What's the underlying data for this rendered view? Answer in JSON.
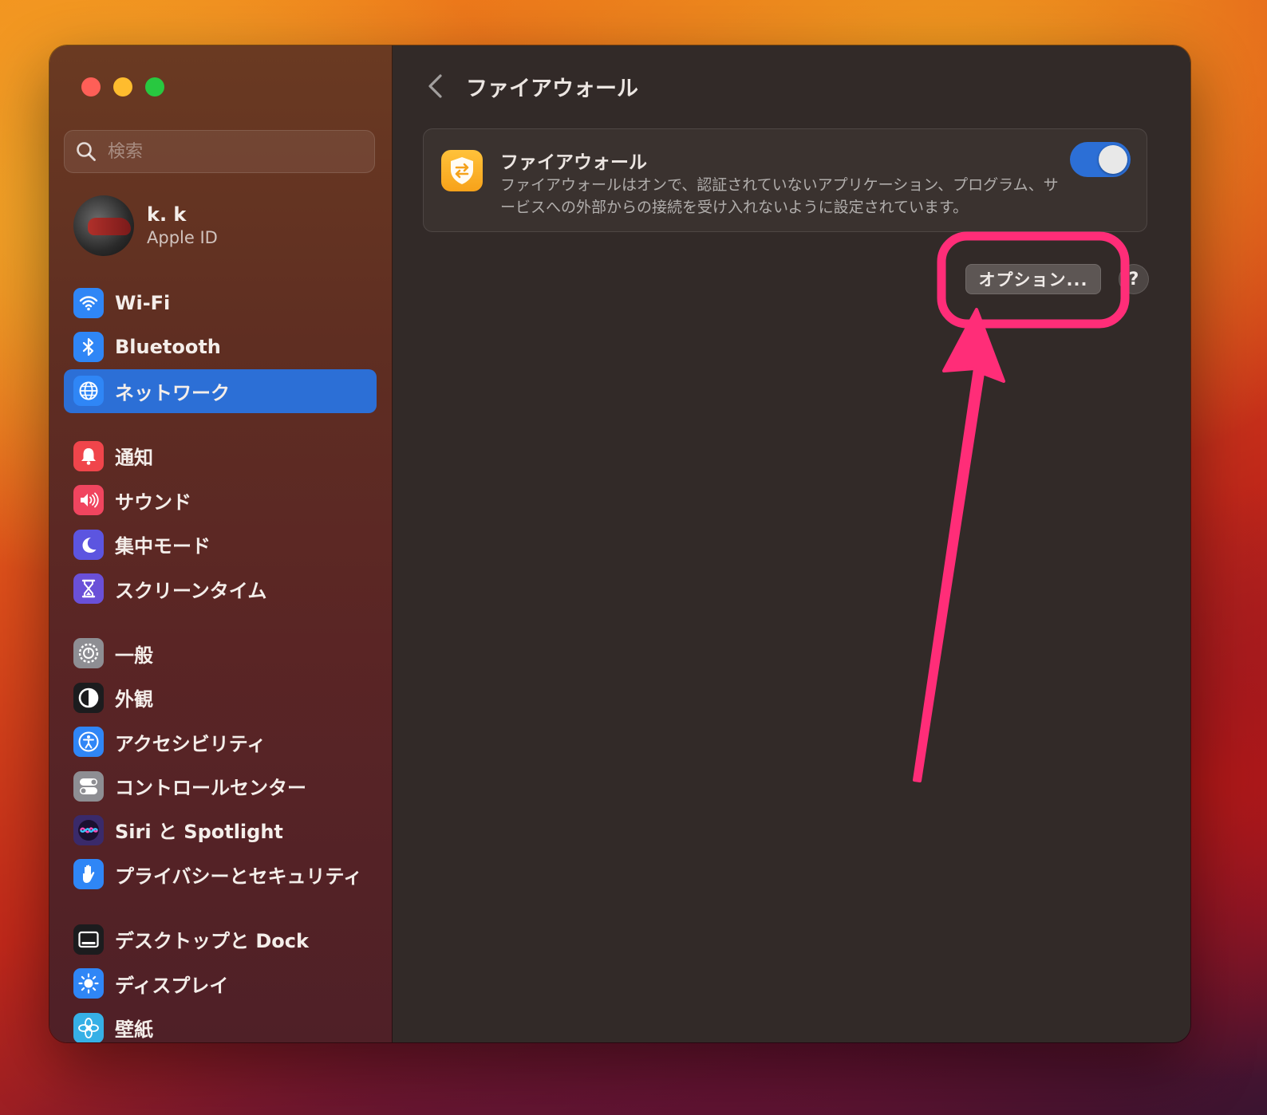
{
  "window": {
    "title": "ファイアウォール"
  },
  "search": {
    "placeholder": "検索"
  },
  "account": {
    "name": "k. k",
    "subtitle": "Apple ID"
  },
  "sidebar": {
    "groups": [
      [
        {
          "label": "Wi-Fi",
          "icon": "wifi-icon",
          "color": "#2f86f6"
        },
        {
          "label": "Bluetooth",
          "icon": "bluetooth-icon",
          "color": "#2f86f6"
        },
        {
          "label": "ネットワーク",
          "icon": "globe-icon",
          "color": "#2f86f6",
          "active": true
        }
      ],
      [
        {
          "label": "通知",
          "icon": "bell-icon",
          "color": "#f0454b"
        },
        {
          "label": "サウンド",
          "icon": "speaker-icon",
          "color": "#f0455f"
        },
        {
          "label": "集中モード",
          "icon": "moon-icon",
          "color": "#5c55e0"
        },
        {
          "label": "スクリーンタイム",
          "icon": "hourglass-icon",
          "color": "#6a50d8"
        }
      ],
      [
        {
          "label": "一般",
          "icon": "gear-icon",
          "color": "#8e8e93"
        },
        {
          "label": "外観",
          "icon": "appearance-icon",
          "color": "#1c1c1e"
        },
        {
          "label": "アクセシビリティ",
          "icon": "accessibility-icon",
          "color": "#2f86f6"
        },
        {
          "label": "コントロールセンター",
          "icon": "toggles-icon",
          "color": "#8e8e93"
        },
        {
          "label": "Siri と Spotlight",
          "icon": "siri-icon",
          "color": "#3a2a6a"
        },
        {
          "label": "プライバシーとセキュリティ",
          "icon": "hand-icon",
          "color": "#2f86f6"
        }
      ],
      [
        {
          "label": "デスクトップと Dock",
          "icon": "dock-icon",
          "color": "#1c1c1e"
        },
        {
          "label": "ディスプレイ",
          "icon": "sun-icon",
          "color": "#2f86f6"
        },
        {
          "label": "壁紙",
          "icon": "flower-icon",
          "color": "#36b0e6"
        }
      ]
    ]
  },
  "firewall": {
    "title": "ファイアウォール",
    "description": "ファイアウォールはオンで、認証されていないアプリケーション、プログラム、サービスへの外部からの接続を受け入れないように設定されています。",
    "enabled": true,
    "options_label": "オプション...",
    "help_label": "?"
  },
  "colors": {
    "accent": "#2c6fd6",
    "annotation": "#ff2d78"
  }
}
